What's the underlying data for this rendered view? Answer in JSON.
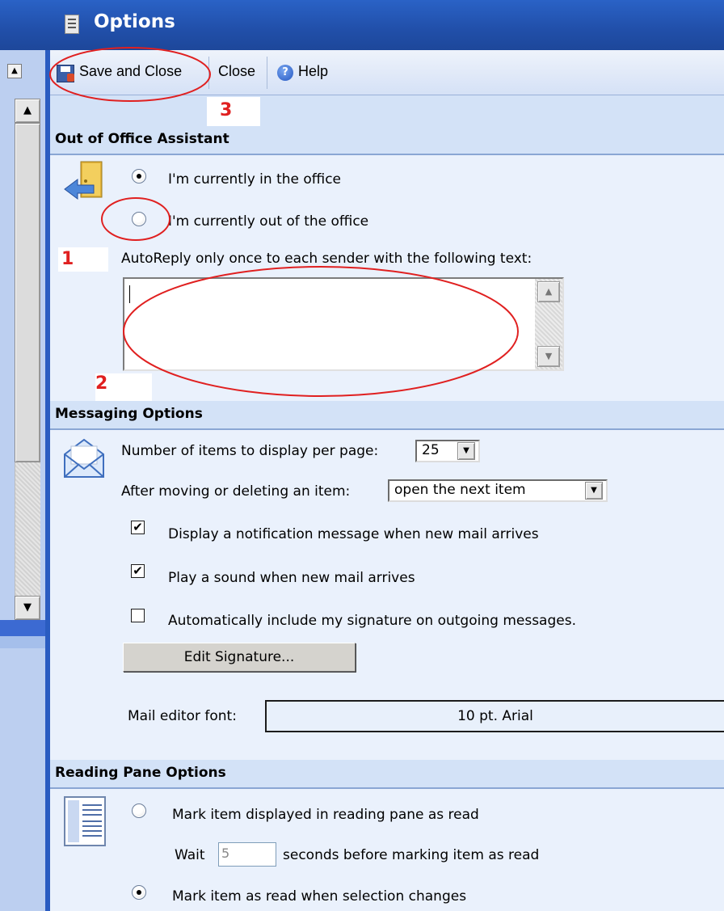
{
  "window": {
    "title": "Options"
  },
  "toolbar": {
    "save_close_label": "Save and Close",
    "close_label": "Close",
    "help_label": "Help",
    "help_icon_glyph": "?"
  },
  "scroll_glyphs": {
    "up": "▲",
    "down": "▼"
  },
  "out_of_office": {
    "header": "Out of Office Assistant",
    "in_office_label": "I'm currently in the office",
    "out_office_label": "I'm currently out of the office",
    "selected": "in_office",
    "autoreply_label": "AutoReply only once to each sender with the following text:",
    "autoreply_text": ""
  },
  "messaging": {
    "header": "Messaging Options",
    "items_per_page_label": "Number of items to display per page:",
    "items_per_page_value": "25",
    "after_move_label": "After moving or deleting an item:",
    "after_move_value": "open the next item",
    "notify_label": "Display a notification message when new mail arrives",
    "notify_checked": true,
    "sound_label": "Play a sound when new mail arrives",
    "sound_checked": true,
    "signature_label": "Automatically include my signature on outgoing messages.",
    "signature_checked": false,
    "edit_signature_button": "Edit Signature...",
    "font_label": "Mail editor font:",
    "font_value": "10 pt. Arial",
    "check_glyph": "✔"
  },
  "reading_pane": {
    "header": "Reading Pane Options",
    "mark_read_label": "Mark item displayed in reading pane as read",
    "wait_label": "Wait",
    "wait_value": "5",
    "seconds_label": "seconds before marking item as read",
    "mark_on_change_label": "Mark item as read when selection changes",
    "selected": "mark_on_change"
  },
  "annotations": {
    "one": "1",
    "two": "2",
    "three": "3"
  },
  "colors": {
    "title_bar": "#2356b8",
    "section_header_bg": "#d3e2f7",
    "section_body_bg": "#eaf1fc",
    "annotation_red": "#e02020"
  },
  "icons": {
    "title": "options-form-icon",
    "save": "save-disk-icon",
    "help": "help-circle-icon",
    "out_of_office": "out-of-office-door-icon",
    "messaging": "envelope-icon",
    "reading_pane": "reading-pane-icon"
  }
}
